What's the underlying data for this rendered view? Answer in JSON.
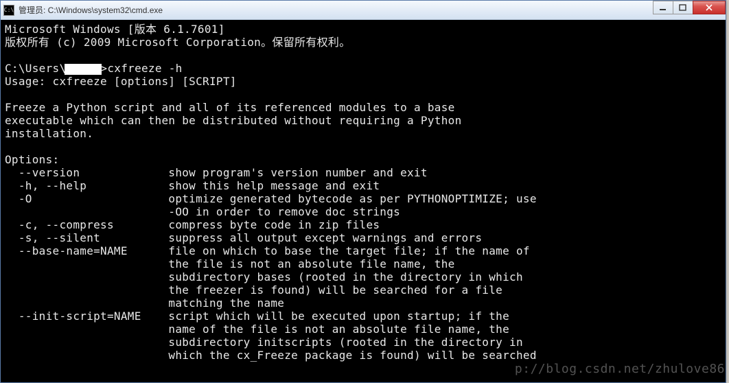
{
  "window": {
    "title": "管理员: C:\\Windows\\system32\\cmd.exe",
    "icon_glyph": "C:\\"
  },
  "console": {
    "line1": "Microsoft Windows [版本 6.1.7601]",
    "line2": "版权所有 (c) 2009 Microsoft Corporation。保留所有权利。",
    "blank": "",
    "prompt_prefix": "C:\\Users\\",
    "prompt_suffix": ">cxfreeze -h",
    "usage": "Usage: cxfreeze [options] [SCRIPT]",
    "desc1": "Freeze a Python script and all of its referenced modules to a base",
    "desc2": "executable which can then be distributed without requiring a Python",
    "desc3": "installation.",
    "options_header": "Options:",
    "opt_version": "  --version             show program's version number and exit",
    "opt_help": "  -h, --help            show this help message and exit",
    "opt_O1": "  -O                    optimize generated bytecode as per PYTHONOPTIMIZE; use",
    "opt_O2": "                        -OO in order to remove doc strings",
    "opt_compress": "  -c, --compress        compress byte code in zip files",
    "opt_silent": "  -s, --silent          suppress all output except warnings and errors",
    "opt_base1": "  --base-name=NAME      file on which to base the target file; if the name of",
    "opt_base2": "                        the file is not an absolute file name, the",
    "opt_base3": "                        subdirectory bases (rooted in the directory in which",
    "opt_base4": "                        the freezer is found) will be searched for a file",
    "opt_base5": "                        matching the name",
    "opt_init1": "  --init-script=NAME    script which will be executed upon startup; if the",
    "opt_init2": "                        name of the file is not an absolute file name, the",
    "opt_init3": "                        subdirectory initscripts (rooted in the directory in",
    "opt_init4": "                        which the cx_Freeze package is found) will be searched"
  },
  "watermark": "p://blog.csdn.net/zhulove86"
}
